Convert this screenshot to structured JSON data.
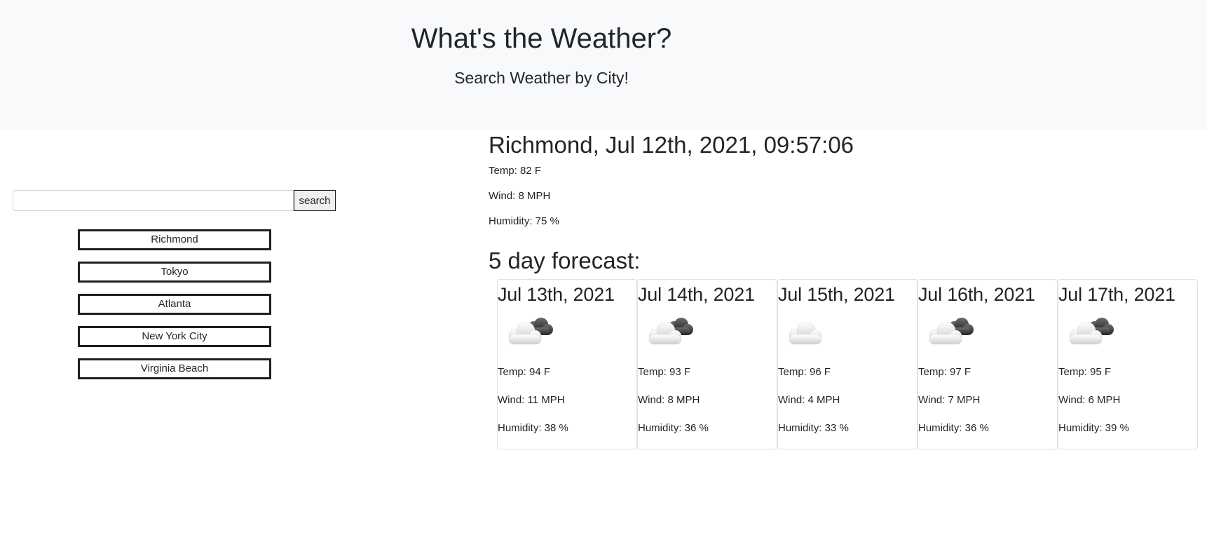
{
  "header": {
    "title": "What's the Weather?",
    "subtitle": "Search Weather by City!"
  },
  "search": {
    "value": "",
    "placeholder": "",
    "button_label": "search"
  },
  "history": [
    "Richmond",
    "Tokyo",
    "Atlanta",
    "New York City",
    "Virginia Beach"
  ],
  "current": {
    "heading": "Richmond, Jul 12th, 2021, 09:57:06",
    "temp": "Temp: 82 F",
    "wind": "Wind: 8 MPH",
    "humidity": "Humidity: 75 %"
  },
  "forecast_title": "5 day forecast:",
  "forecast": [
    {
      "date": "Jul 13th, 2021",
      "icon": "partly-cloudy-icon",
      "temp": "Temp: 94 F",
      "wind": "Wind: 11 MPH",
      "humidity": "Humidity: 38 %"
    },
    {
      "date": "Jul 14th, 2021",
      "icon": "partly-cloudy-icon",
      "temp": "Temp: 93 F",
      "wind": "Wind: 8 MPH",
      "humidity": "Humidity: 36 %"
    },
    {
      "date": "Jul 15th, 2021",
      "icon": "cloud-icon",
      "temp": "Temp: 96 F",
      "wind": "Wind: 4 MPH",
      "humidity": "Humidity: 33 %"
    },
    {
      "date": "Jul 16th, 2021",
      "icon": "partly-cloudy-icon",
      "temp": "Temp: 97 F",
      "wind": "Wind: 7 MPH",
      "humidity": "Humidity: 36 %"
    },
    {
      "date": "Jul 17th, 2021",
      "icon": "partly-cloudy-icon",
      "temp": "Temp: 95 F",
      "wind": "Wind: 6 MPH",
      "humidity": "Humidity: 39 %"
    }
  ]
}
